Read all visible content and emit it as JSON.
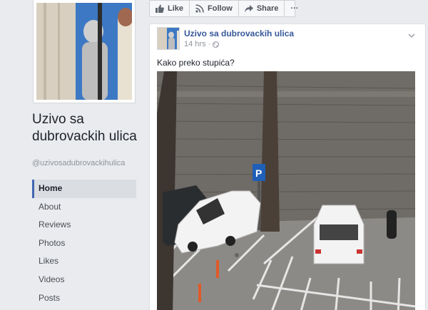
{
  "sidebar": {
    "page_name": "Uzivo sa dubrovackih ulica",
    "handle": "@uzivosadubrovackihulica",
    "nav": [
      "Home",
      "About",
      "Reviews",
      "Photos",
      "Likes",
      "Videos",
      "Posts"
    ],
    "active": "Home"
  },
  "actions": {
    "like_label": "Like",
    "follow_label": "Follow",
    "share_label": "Share",
    "more_label": "···"
  },
  "post": {
    "author": "Uzivo sa dubrovackih ulica",
    "time": "14 hrs",
    "separator": "·",
    "text": "Kako preko stupića?"
  },
  "colors": {
    "link": "#365899",
    "accent": "#4267b2",
    "background": "#e9ebee"
  }
}
